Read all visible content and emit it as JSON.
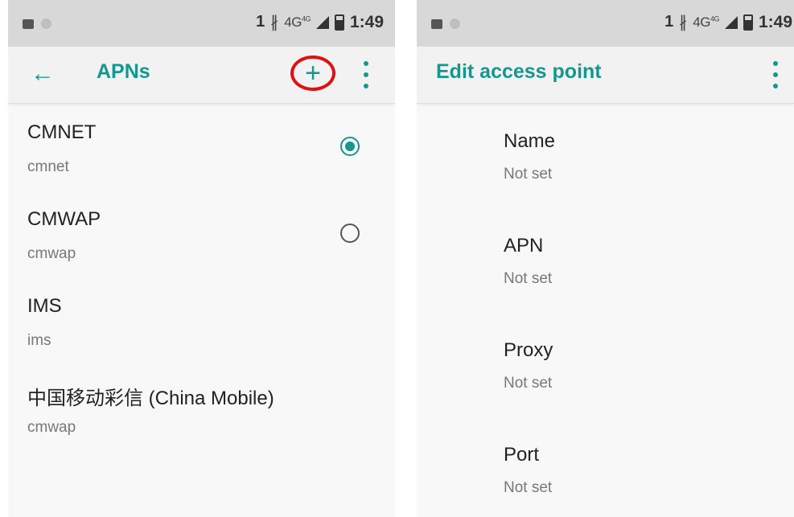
{
  "left": {
    "statusbar": {
      "sim_slot": "1",
      "bluetooth_icon": "bluetooth-icon",
      "network": "4G",
      "network_sup": "4G",
      "time": "1:49"
    },
    "toolbar": {
      "title": "APNs",
      "add_icon": "+",
      "more_icon": "more-vert-icon"
    },
    "apns": [
      {
        "name": "CMNET",
        "sub": "cmnet",
        "selected": true
      },
      {
        "name": "CMWAP",
        "sub": "cmwap",
        "selected": false
      },
      {
        "name": "IMS",
        "sub": "ims"
      },
      {
        "name": "中国移动彩信 (China Mobile)",
        "sub": "cmwap"
      }
    ]
  },
  "right": {
    "statusbar": {
      "sim_slot": "1",
      "bluetooth_icon": "bluetooth-icon",
      "network": "4G",
      "network_sup": "4G",
      "time": "1:49"
    },
    "toolbar": {
      "title": "Edit access point",
      "more_icon": "more-vert-icon"
    },
    "fields": [
      {
        "label": "Name",
        "value": "Not set"
      },
      {
        "label": "APN",
        "value": "Not set"
      },
      {
        "label": "Proxy",
        "value": "Not set"
      },
      {
        "label": "Port",
        "value": "Not set"
      }
    ]
  },
  "colors": {
    "accent": "#14978f",
    "highlight_circle": "#e01010",
    "statusbar_bg": "#d8d8d8",
    "background": "#f8f8f8"
  }
}
